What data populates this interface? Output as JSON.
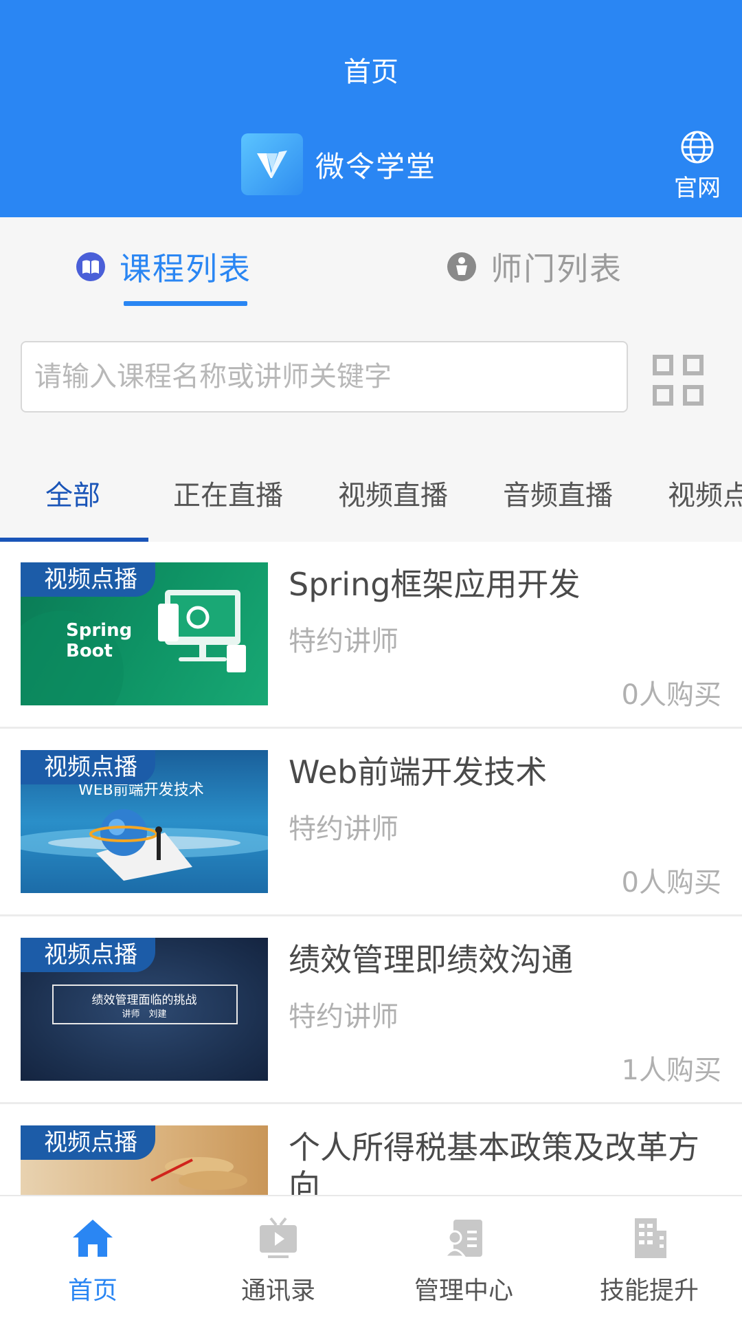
{
  "header": {
    "title": "首页",
    "brand_name": "微令学堂",
    "website_label": "官网"
  },
  "segments": [
    {
      "label": "课程列表",
      "active": true
    },
    {
      "label": "师门列表",
      "active": false
    }
  ],
  "search": {
    "placeholder": "请输入课程名称或讲师关键字",
    "value": ""
  },
  "categories": [
    {
      "label": "全部",
      "active": true
    },
    {
      "label": "正在直播",
      "active": false
    },
    {
      "label": "视频直播",
      "active": false
    },
    {
      "label": "音频直播",
      "active": false
    },
    {
      "label": "视频点播",
      "active": false
    }
  ],
  "courses": [
    {
      "badge": "视频点播",
      "title": "Spring框架应用开发",
      "teacher": "特约讲师",
      "sales": "0人购买",
      "thumb_text": "Spring\nBoot"
    },
    {
      "badge": "视频点播",
      "title": "Web前端开发技术",
      "teacher": "特约讲师",
      "sales": "0人购买",
      "thumb_text": "WEB前端开发技术"
    },
    {
      "badge": "视频点播",
      "title": "绩效管理即绩效沟通",
      "teacher": "特约讲师",
      "sales": "1人购买",
      "thumb_text": "绩效管理面临的挑战",
      "thumb_subtext": "讲师　刘建"
    },
    {
      "badge": "视频点播",
      "title": "个人所得税基本政策及改革方向",
      "teacher": "",
      "sales": ""
    }
  ],
  "bottom_nav": [
    {
      "label": "首页",
      "icon": "home-icon",
      "active": true
    },
    {
      "label": "通讯录",
      "icon": "tv-icon",
      "active": false
    },
    {
      "label": "管理中心",
      "icon": "contact-card-icon",
      "active": false
    },
    {
      "label": "技能提升",
      "icon": "building-icon",
      "active": false
    }
  ],
  "colors": {
    "primary": "#2a86f3",
    "category_active": "#1a55b8",
    "badge": "#1c5ca8"
  }
}
